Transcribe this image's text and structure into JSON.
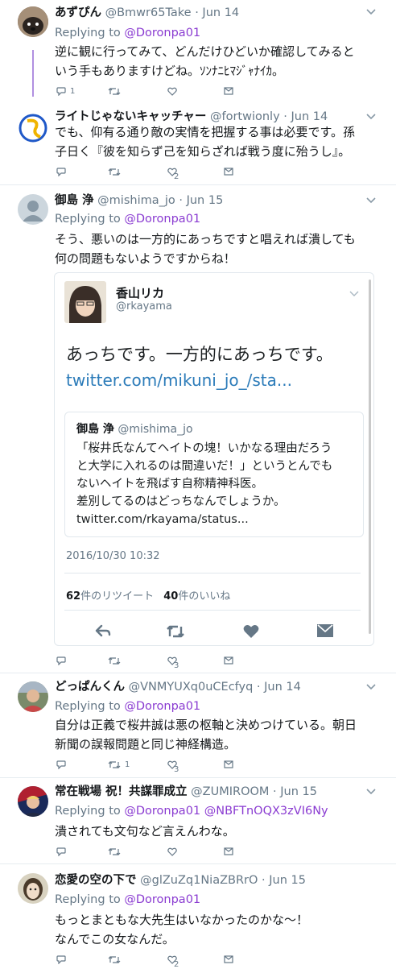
{
  "tweets": [
    {
      "name": "あずぴん",
      "handle": "@Bmwr65Take · Jun 14",
      "replying_prefix": "Replying to ",
      "replying_to": "@Doronpa01",
      "line1": "逆に観に行ってみて、どんだけひどいか確認してみると",
      "line2": "いう手もありますけどね。ｿﾝﾅﾆﾋﾏｼﾞｬﾅｲｶ。",
      "reply_count": "1",
      "retweet_count": "",
      "like_count": ""
    },
    {
      "name": "ライトじゃないキャッチャー",
      "handle": "@fortwionly · Jun 14",
      "line1": "でも、仰有る通り敵の実情を把握する事は必要です。孫",
      "line2": "子日く『彼を知らず己を知らざれば戦う度に殆うし』。",
      "reply_count": "",
      "retweet_count": "",
      "like_count": "2"
    },
    {
      "name": "御島 浄",
      "handle": "@mishima_jo · Jun 15",
      "replying_prefix": "Replying to ",
      "replying_to": "@Doronpa01",
      "line1": "そう、悪いのは一方的にあっちですと唱えれば潰しても",
      "line2": "何の問題もないようですからね！",
      "reply_count": "",
      "retweet_count": "",
      "like_count": "3",
      "embed": {
        "name": "香山リカ",
        "handle": "@rkayama",
        "text": "あっちです。一方的にあっちです。",
        "link": "twitter.com/mikuni_jo_/sta...",
        "quote_name": "御島 浄",
        "quote_handle": "@mishima_jo",
        "quote_line1": "「桜井氏なんてヘイトの塊！いかなる理由だろう",
        "quote_line2": "と大学に入れるのは間違いだ！」というとんでも",
        "quote_line3": "ないヘイトを飛ばす自称精神科医。",
        "quote_line4": "差別してるのはどっちなんでしょうか。",
        "quote_link": "twitter.com/rkayama/status...",
        "timestamp": "2016/10/30 10:32",
        "retweets_num": "62",
        "retweets_label": "件のリツイート",
        "likes_num": "40",
        "likes_label": "件のいいね"
      }
    },
    {
      "name": "どっぱんくん",
      "handle": "@VNMYUXq0uCEcfyq · Jun 14",
      "replying_prefix": "Replying to ",
      "replying_to": "@Doronpa01",
      "line1": "自分は正義で桜井誠は悪の枢軸と決めつけている。朝日",
      "line2": "新聞の誤報問題と同じ神経構造。",
      "reply_count": "",
      "retweet_count": "1",
      "like_count": "3"
    },
    {
      "name": "常在戦場 祝！共謀罪成立",
      "handle": "@ZUMIROOM · Jun 15",
      "replying_prefix": "Replying to ",
      "replying_to": "@Doronpa01 @NBFTnOQX3zVI6Ny",
      "line1": "潰されても文句など言えんわな。",
      "reply_count": "",
      "retweet_count": "",
      "like_count": ""
    },
    {
      "name": "恋愛の空の下で",
      "handle": "@glZuZq1NiaZBRrO · Jun 15",
      "replying_prefix": "Replying to ",
      "replying_to": "@Doronpa01",
      "line1": "もっとまともな大先生はいなかったのかな～！",
      "line2": "なんでこの女なんだ。",
      "reply_count": "",
      "retweet_count": "",
      "like_count": "2"
    }
  ],
  "colors": {
    "mention": "#8a3bd1",
    "link": "#1da1f2",
    "muted": "#657786"
  }
}
